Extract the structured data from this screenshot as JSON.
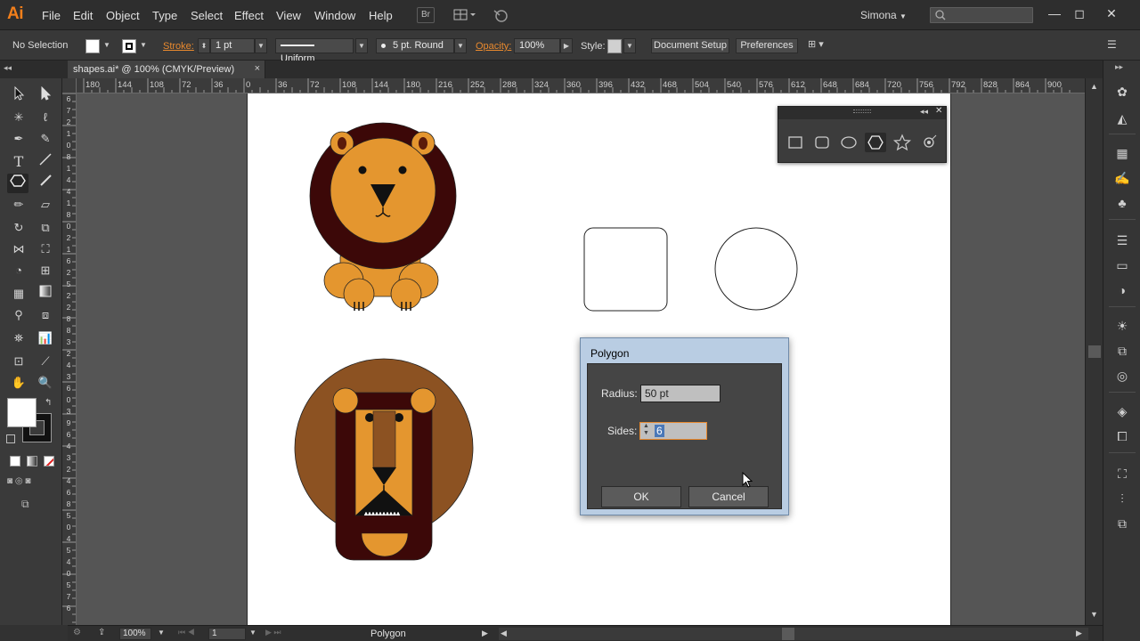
{
  "app": {
    "logo": "Ai",
    "menu": [
      "File",
      "Edit",
      "Object",
      "Type",
      "Select",
      "Effect",
      "View",
      "Window",
      "Help"
    ],
    "bridge_label": "Br",
    "user": "Simona"
  },
  "control_bar": {
    "selection_status": "No Selection",
    "stroke_label": "Stroke:",
    "stroke_weight": "1 pt",
    "stroke_profile": "Uniform",
    "brush": "5 pt. Round",
    "opacity_label": "Opacity:",
    "opacity_value": "100%",
    "style_label": "Style:",
    "document_setup": "Document Setup",
    "preferences": "Preferences"
  },
  "document_tab": {
    "title": "shapes.ai* @ 100% (CMYK/Preview)",
    "close": "×"
  },
  "ruler": {
    "top_labels": [
      "180",
      "144",
      "108",
      "72",
      "36",
      "0",
      "36",
      "72",
      "108",
      "144",
      "180",
      "216",
      "252",
      "288",
      "324",
      "360",
      "396",
      "432",
      "468",
      "504",
      "540",
      "576",
      "612",
      "648",
      "684",
      "720",
      "756",
      "792",
      "828",
      "864",
      "900"
    ],
    "left_labels": [
      "6",
      "7",
      "2",
      "1",
      "0",
      "8",
      "1",
      "4",
      "4",
      "1",
      "8",
      "0",
      "2",
      "1",
      "6",
      "2",
      "5",
      "2",
      "2",
      "8",
      "8",
      "3",
      "2",
      "4",
      "3",
      "6",
      "0",
      "3",
      "9",
      "6",
      "4",
      "3",
      "2",
      "4",
      "6",
      "8",
      "5",
      "0",
      "4",
      "5",
      "4",
      "0",
      "5",
      "7",
      "6"
    ]
  },
  "shape_panel": {
    "tools": [
      "rectangle",
      "rounded-rectangle",
      "ellipse",
      "polygon",
      "star",
      "flare"
    ],
    "active": "polygon"
  },
  "dialog": {
    "title": "Polygon",
    "radius_label": "Radius:",
    "radius_value": "50 pt",
    "sides_label": "Sides:",
    "sides_value": "6",
    "ok_label": "OK",
    "cancel_label": "Cancel"
  },
  "status_bar": {
    "zoom": "100%",
    "artboard_number": "1",
    "current_tool": "Polygon"
  },
  "colors": {
    "lion_mane_dark": "#3c0808",
    "lion_face": "#e4962f",
    "lion_mane_brown": "#8c5222",
    "accent_orange": "#f27f1b",
    "dialog_title_bg": "#b9cde3"
  }
}
